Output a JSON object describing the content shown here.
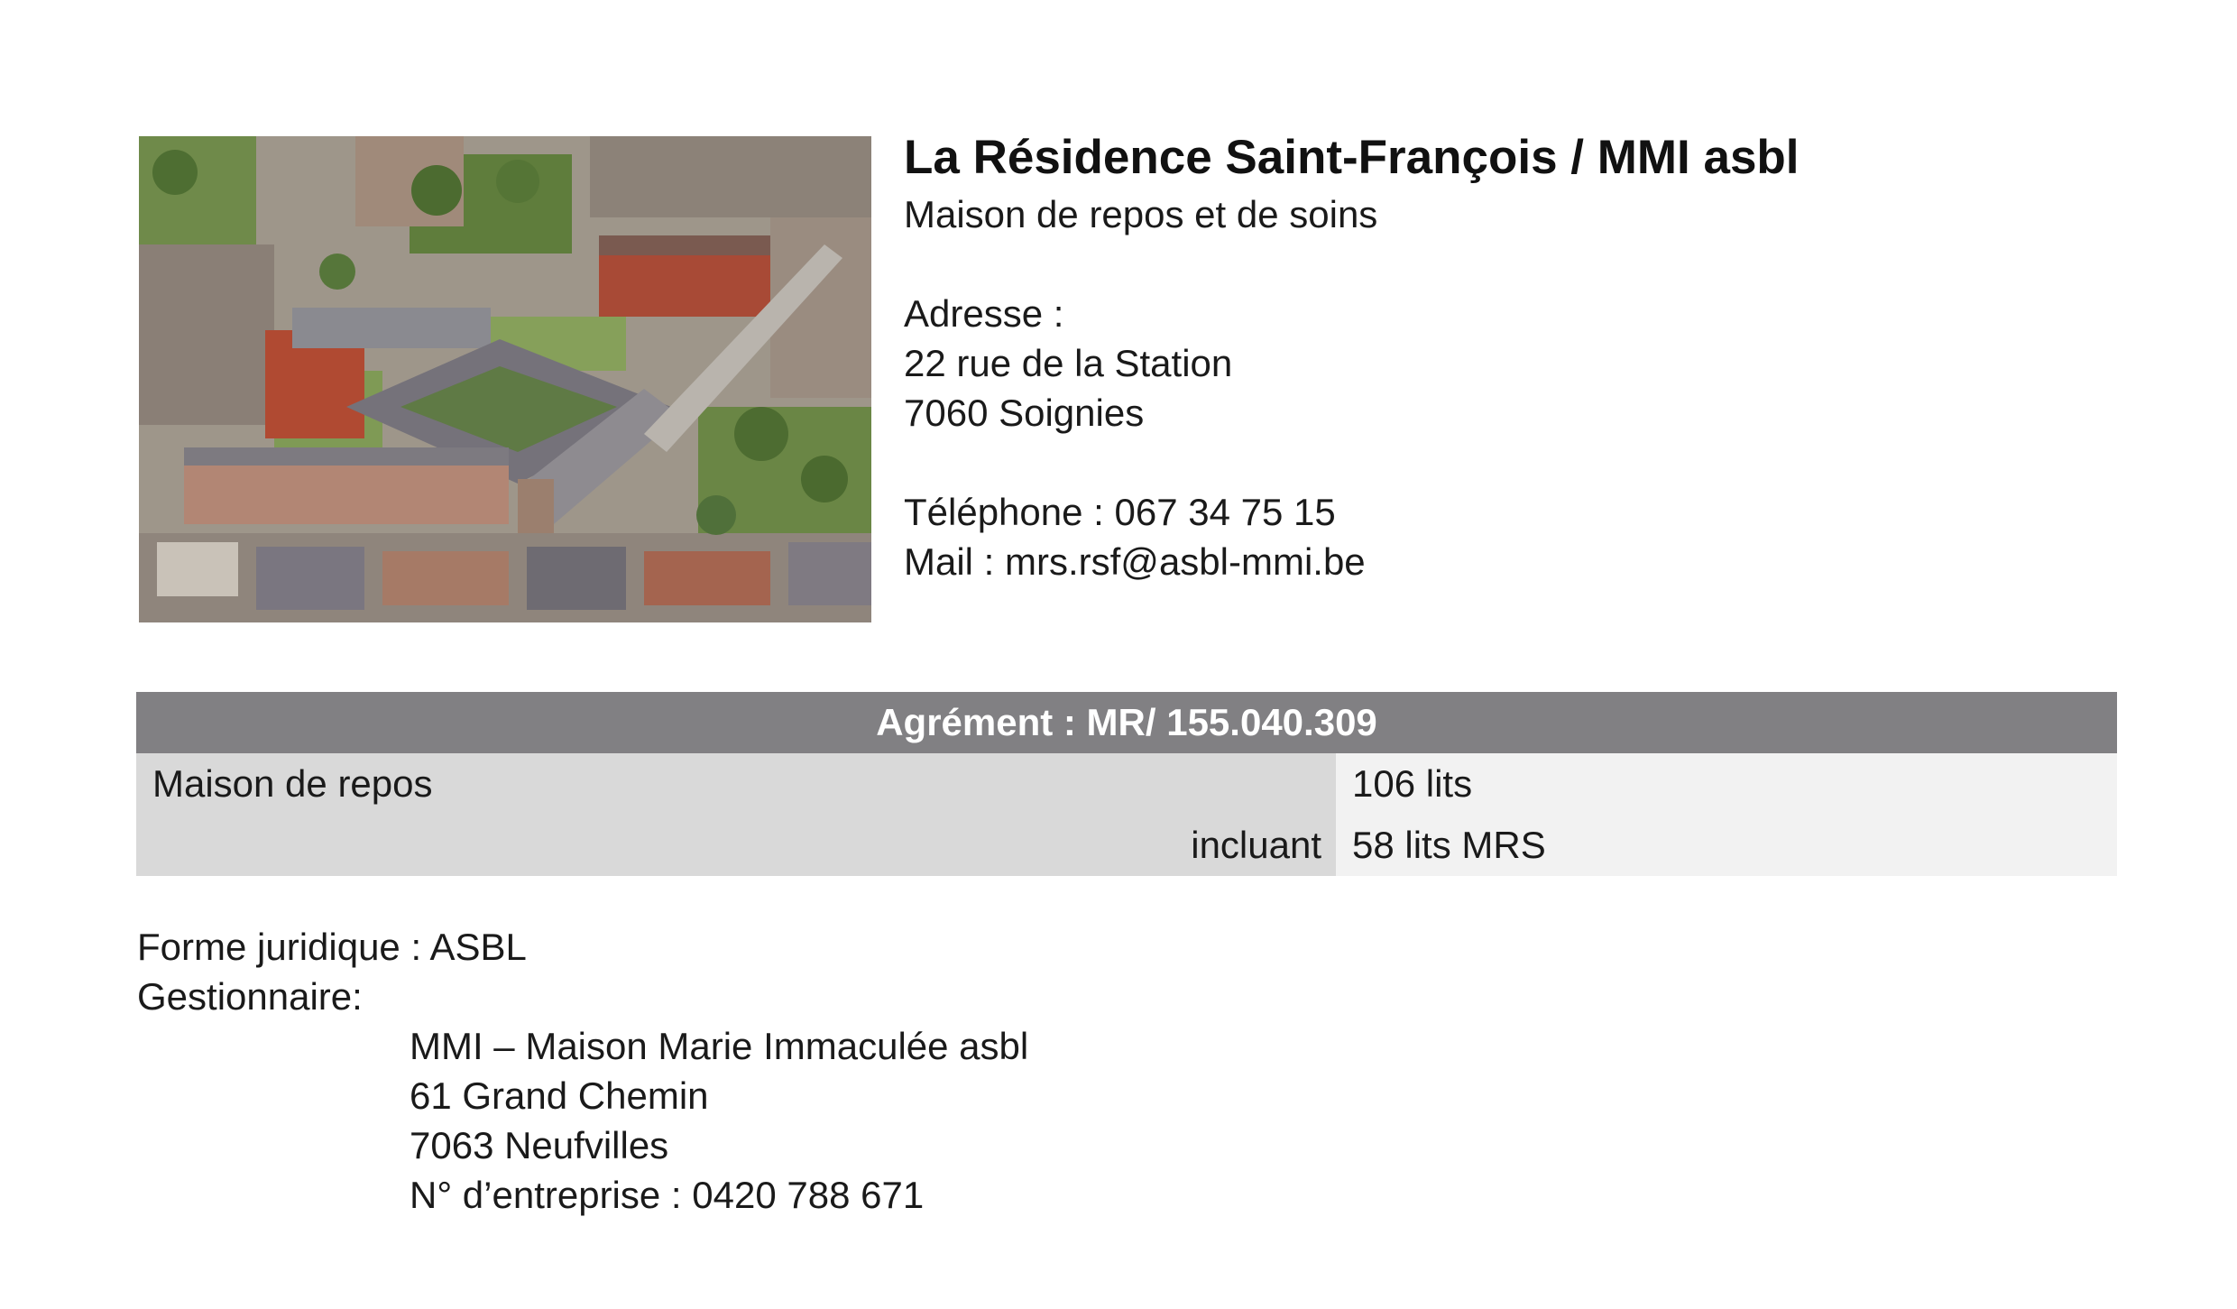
{
  "photo": {
    "icon": "aerial-photo-residence"
  },
  "header": {
    "title": "La Résidence Saint-François / MMI asbl",
    "subtitle": "Maison de repos et de soins"
  },
  "address": {
    "label": "Adresse :",
    "street": "22 rue de la Station",
    "city": "7060 Soignies"
  },
  "contact": {
    "phone": "Téléphone : 067 34 75 15",
    "mail": "Mail : mrs.rsf@asbl-mmi.be"
  },
  "agrement": {
    "header": "Agrément : MR/ 155.040.309",
    "rows": [
      {
        "label": "Maison de repos",
        "value": "106 lits"
      },
      {
        "label": "incluant",
        "value": "58 lits MRS"
      }
    ]
  },
  "legal": {
    "forme": "Forme juridique : ASBL",
    "gestionnaire_label": "Gestionnaire:",
    "gestionnaire_name": "MMI – Maison Marie Immaculée asbl",
    "gestionnaire_street": "61 Grand Chemin",
    "gestionnaire_city": "7063 Neufvilles",
    "entreprise": "N° d’entreprise : 0420 788 671"
  }
}
